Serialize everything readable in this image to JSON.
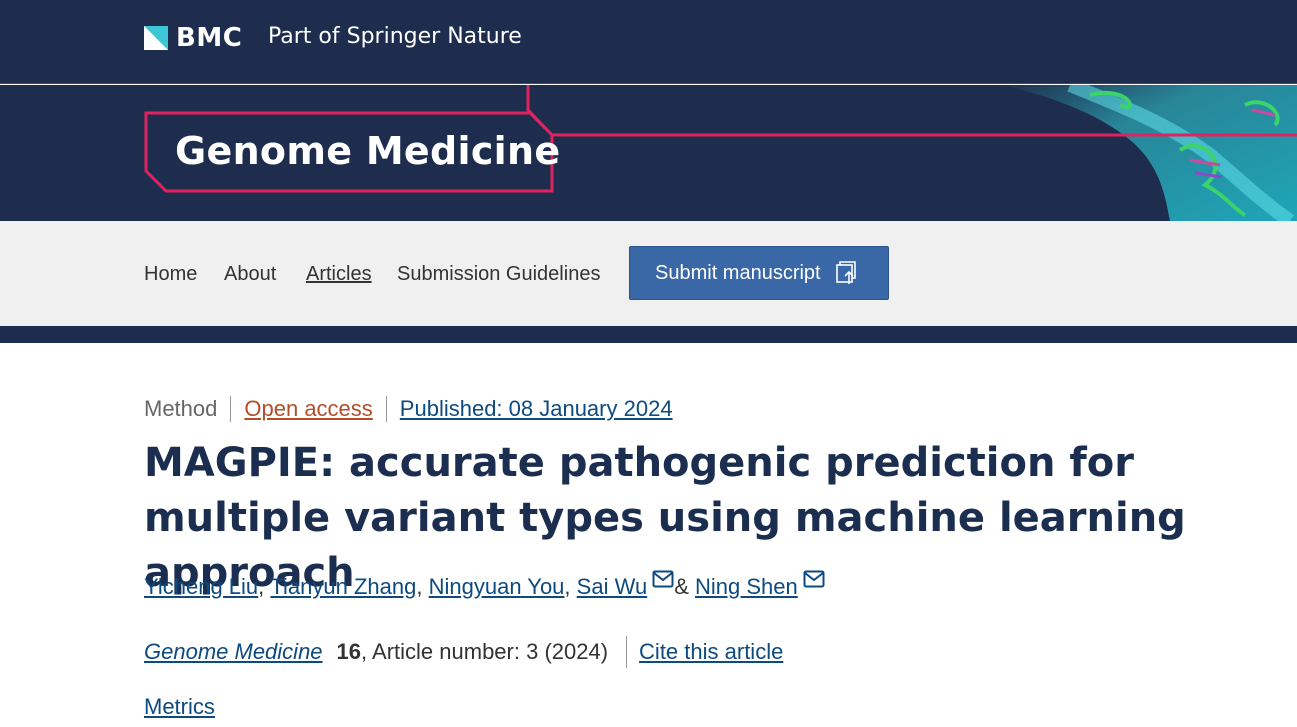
{
  "brand": {
    "logo_text": "BMC",
    "tagline": "Part of Springer Nature"
  },
  "journal": {
    "title": "Genome Medicine"
  },
  "nav": {
    "items": [
      "Home",
      "About",
      "Articles",
      "Submission Guidelines"
    ],
    "active": "Articles",
    "submit_label": "Submit manuscript",
    "submit_icon": "submit-upload-icon"
  },
  "article": {
    "type": "Method",
    "access": "Open access",
    "published": "Published: 08 January 2024",
    "title": "MAGPIE: accurate pathogenic prediction for multiple variant types using machine learning approach",
    "authors": [
      {
        "name": "Yicheng Liu",
        "sep": ","
      },
      {
        "name": "Tianyun Zhang",
        "sep": ","
      },
      {
        "name": "Ningyuan You",
        "sep": ","
      },
      {
        "name": "Sai Wu",
        "email": true,
        "sep": " &"
      },
      {
        "name": "Ning Shen",
        "email": true,
        "sep": ""
      }
    ],
    "journal_name": "Genome Medicine",
    "volume": "16",
    "article_number": ", Article number: 3 (2024)",
    "cite_label": "Cite this article",
    "metrics_label": "Metrics"
  },
  "colors": {
    "header_bg": "#1e2d4d",
    "accent_pink": "#e0235f",
    "link": "#0c4a80",
    "open_access": "#b34e2b",
    "button": "#3a68a6",
    "title_text": "#1b2e4f"
  }
}
